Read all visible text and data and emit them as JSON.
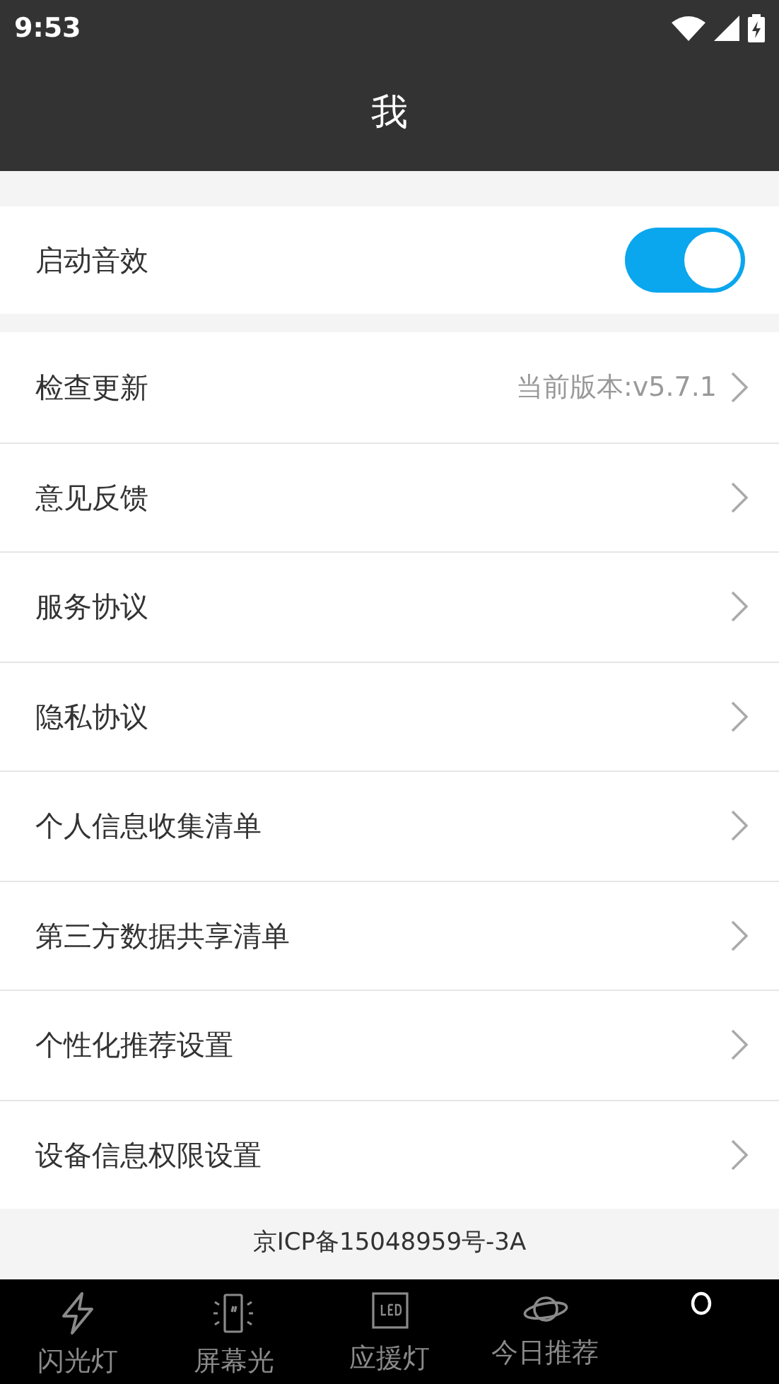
{
  "status_bar": {
    "time": "9:53"
  },
  "header": {
    "title": "我"
  },
  "sound_setting": {
    "label": "启动音效",
    "on": true
  },
  "menu": [
    {
      "label": "检查更新",
      "value": "当前版本:v5.7.1"
    },
    {
      "label": "意见反馈"
    },
    {
      "label": "服务协议"
    },
    {
      "label": "隐私协议"
    },
    {
      "label": "个人信息收集清单"
    },
    {
      "label": "第三方数据共享清单"
    },
    {
      "label": "个性化推荐设置"
    },
    {
      "label": "设备信息权限设置"
    }
  ],
  "footer": {
    "icp": "京ICP备15048959号-3A"
  },
  "tab_bar": [
    {
      "kind": "flash",
      "label": "闪光灯",
      "selected": false
    },
    {
      "kind": "screen",
      "label": "屏幕光",
      "selected": false
    },
    {
      "kind": "led",
      "label": "应援灯",
      "selected": false
    },
    {
      "kind": "planet",
      "label": "今日推荐",
      "selected": false
    },
    {
      "kind": "profile",
      "selected": true
    }
  ]
}
